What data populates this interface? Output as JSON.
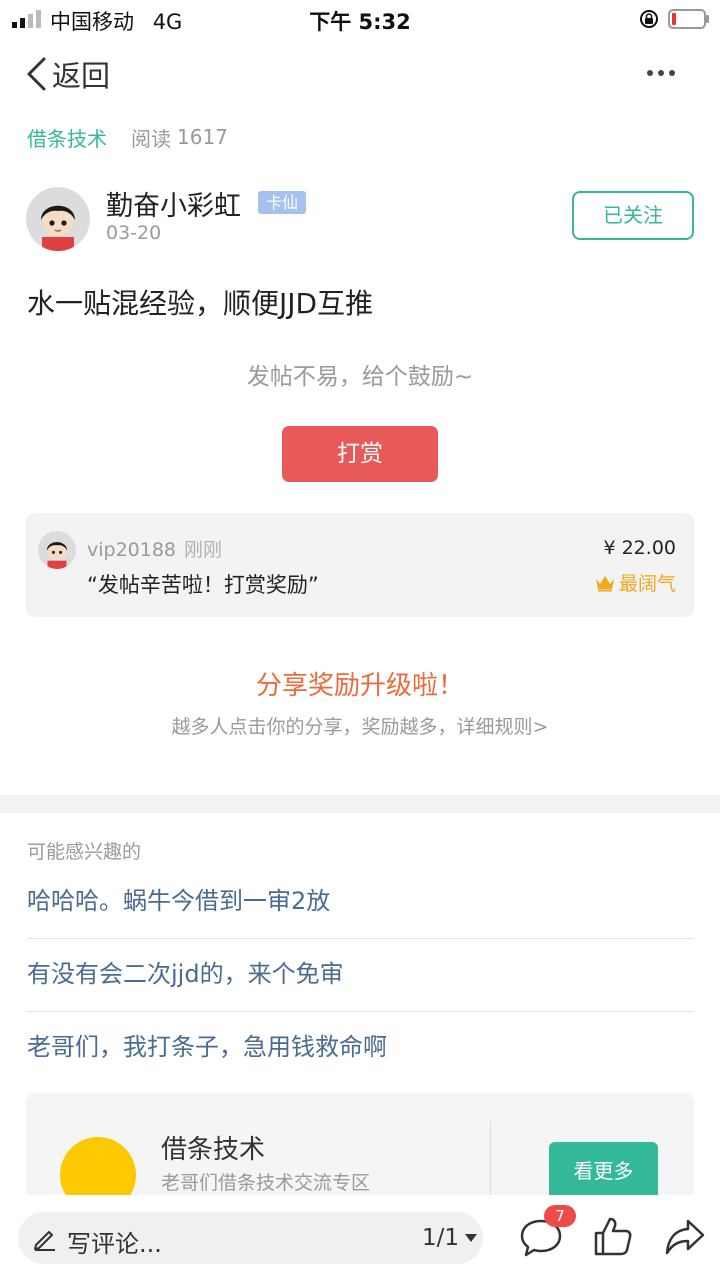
{
  "status_bar": {
    "carrier": "中国移动",
    "network": "4G",
    "time": "下午 5:32"
  },
  "nav": {
    "back_label": "返回",
    "icons": {
      "back": "chevron-left-icon",
      "more": "more-dots-icon"
    }
  },
  "meta": {
    "forum_name": "借条技术",
    "read_label": "阅读",
    "read_count": "1617"
  },
  "author": {
    "name": "勤奋小彩虹",
    "badge": "卡仙",
    "date": "03-20",
    "follow_label": "已关注"
  },
  "post": {
    "title": "水一贴混经验，顺便JJD互推"
  },
  "reward": {
    "hint": "发帖不易，给个鼓励~",
    "button_label": "打赏",
    "record": {
      "user": "vip20188",
      "time": "刚刚",
      "message": "“发帖辛苦啦！打赏奖励”",
      "amount": "¥ 22.00",
      "top_label": "最阔气"
    }
  },
  "share": {
    "title": "分享奖励升级啦！",
    "desc": "越多人点击你的分享，奖励越多，详细规则>"
  },
  "related": {
    "header": "可能感兴趣的",
    "items": [
      "哈哈哈。蜗牛今借到一审2放",
      "有没有会二次jjd的，来个免审",
      "老哥们，我打条子，急用钱救命啊"
    ]
  },
  "forum_card": {
    "name": "借条技术",
    "desc": "老哥们借条技术交流专区",
    "more_label": "看更多"
  },
  "bottom_bar": {
    "comment_placeholder": "写评论...",
    "page": "1/1",
    "comment_badge": "7",
    "icons": {
      "pen": "pen-icon",
      "comment": "comment-icon",
      "like": "thumbs-up-icon",
      "share": "share-arrow-icon"
    }
  },
  "colors": {
    "accent_green": "#33b99a",
    "reward_red": "#e85a57",
    "share_orange": "#ec6a3b",
    "link_blue": "#4a6b93",
    "badge_blue": "#a5c2ef",
    "gold": "#f2a81b"
  }
}
